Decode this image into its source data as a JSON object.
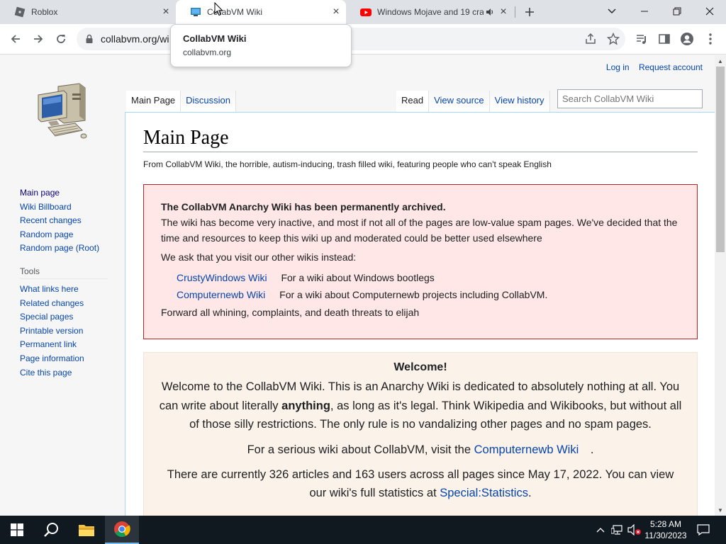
{
  "tabs": [
    {
      "title": "Roblox",
      "icon": "roblox-icon",
      "close": "×"
    },
    {
      "title": "CollabVM Wiki",
      "icon": "computer-favicon",
      "close": "×"
    },
    {
      "title": "Windows Mojave and 19 cra",
      "icon": "youtube-icon",
      "close": "×",
      "audio": "speaker-icon"
    }
  ],
  "hovercard": {
    "title": "CollabVM Wiki",
    "url": "collabvm.org"
  },
  "toolbar": {
    "url": "collabvm.org/wi"
  },
  "personal": {
    "login": "Log in",
    "request": "Request account"
  },
  "sidebar": {
    "nav": [
      "Main page",
      "Wiki Billboard",
      "Recent changes",
      "Random page",
      "Random page (Root)"
    ],
    "tools_title": "Tools",
    "tools": [
      "What links here",
      "Related changes",
      "Special pages",
      "Printable version",
      "Permanent link",
      "Page information",
      "Cite this page"
    ]
  },
  "page_tabs": {
    "left": [
      "Main Page",
      "Discussion"
    ],
    "right": [
      "Read",
      "View source",
      "View history"
    ],
    "search_placeholder": "Search CollabVM Wiki"
  },
  "content": {
    "heading": "Main Page",
    "sitesub": "From CollabVM Wiki, the horrible, autism-inducing, trash filled wiki, featuring people who can't speak English",
    "notice": {
      "title": "The CollabVM Anarchy Wiki has been permanently archived.",
      "body": "The wiki has become very inactive, and most if not all of the pages are low-value spam pages. We've decided that the time and resources to keep this wiki up and moderated could be better used elsewhere",
      "ask": "We ask that you visit our other wikis instead:",
      "wikis": [
        {
          "name": "CrustyWindows Wiki",
          "desc": "For a wiki about Windows bootlegs"
        },
        {
          "name": "Computernewb Wiki",
          "desc": "For a wiki about Computernewb projects including CollabVM."
        }
      ],
      "footer": "Forward all whining, complaints, and death threats to elijah"
    },
    "welcome": {
      "heading": "Welcome!",
      "p1_a": "Welcome to the CollabVM Wiki. This is an Anarchy Wiki is dedicated to absolutely nothing at all. You can write about literally ",
      "p1_bold": "anything",
      "p1_b": ", as long as it's legal. Think Wikipedia and Wikibooks, but without all of those silly restrictions. The only rule is no vandalizing other pages and no spam pages.",
      "p2_a": "For a serious wiki about CollabVM, visit the ",
      "p2_link": "Computernewb Wiki",
      "p2_b": " .",
      "p3_a": "There are currently 326 articles and 163 users across all pages since May 17, 2022. You can view our wiki's full statistics at ",
      "p3_link": "Special:Statistics",
      "p3_b": "."
    }
  },
  "taskbar": {
    "time": "5:28 AM",
    "date": "11/30/2023"
  },
  "colors": {
    "link": "#0645ad",
    "notice_bg": "#fee7e6",
    "notice_border": "#b32424",
    "welcome_bg": "#fbf2ea",
    "taskbar": "#101820"
  }
}
